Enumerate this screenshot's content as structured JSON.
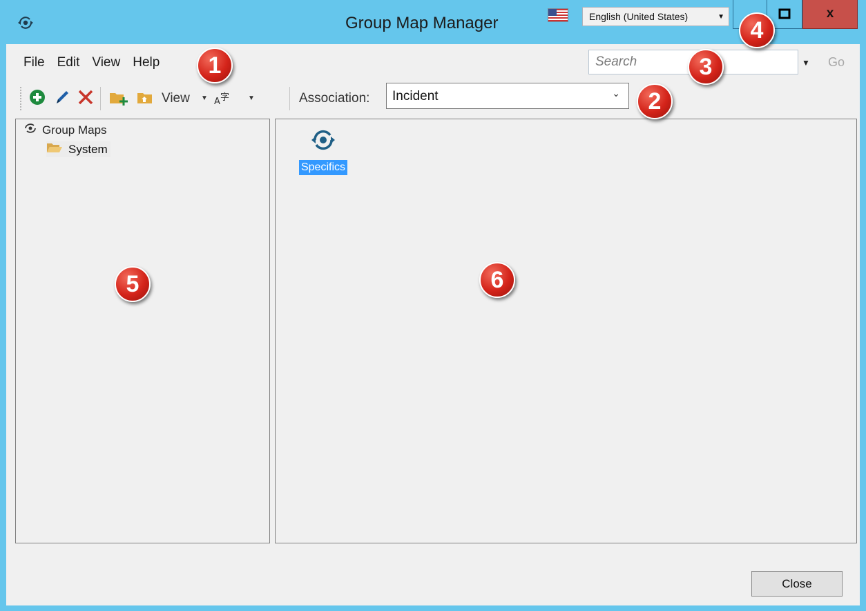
{
  "window": {
    "title": "Group Map Manager",
    "language": "English (United States)",
    "close_symbol": "x"
  },
  "menu": {
    "items": [
      {
        "label": "File"
      },
      {
        "label": "Edit"
      },
      {
        "label": "View"
      },
      {
        "label": "Help"
      }
    ]
  },
  "search": {
    "placeholder": "Search",
    "go_label": "Go"
  },
  "toolbar": {
    "view_label": "View",
    "association_label": "Association:",
    "association_value": "Incident",
    "icons": [
      "add-icon",
      "edit-icon",
      "delete-icon",
      "new-folder-icon",
      "folder-up-icon",
      "font-icon"
    ]
  },
  "tree": {
    "root_label": "Group Maps",
    "child_label": "System"
  },
  "content": {
    "item_label": "Specifics"
  },
  "footer": {
    "close_label": "Close"
  },
  "callouts": [
    "1",
    "2",
    "3",
    "4",
    "5",
    "6"
  ],
  "colors": {
    "titlebar": "#65c6ec",
    "close_button": "#c7504a",
    "selection": "#3399ff",
    "callout": "#d4241a"
  }
}
